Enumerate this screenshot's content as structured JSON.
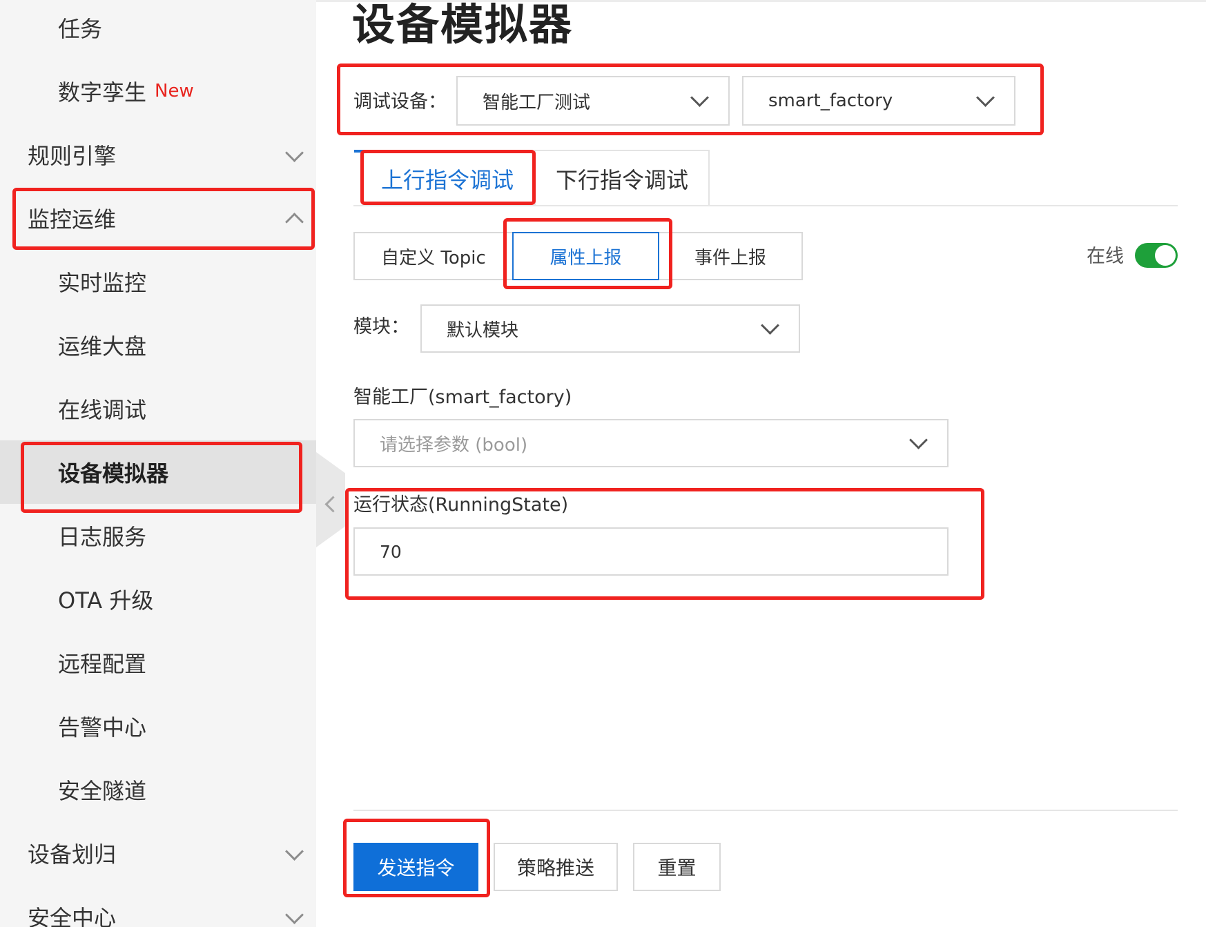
{
  "sidebar": {
    "items": [
      {
        "label": "任务"
      },
      {
        "label": "数字孪生",
        "badge": "New"
      },
      {
        "label": "规则引擎"
      },
      {
        "label": "监控运维"
      },
      {
        "label": "实时监控"
      },
      {
        "label": "运维大盘"
      },
      {
        "label": "在线调试"
      },
      {
        "label": "设备模拟器"
      },
      {
        "label": "日志服务"
      },
      {
        "label": "OTA 升级"
      },
      {
        "label": "远程配置"
      },
      {
        "label": "告警中心"
      },
      {
        "label": "安全隧道"
      },
      {
        "label": "设备划归"
      },
      {
        "label": "安全中心"
      }
    ]
  },
  "main": {
    "title": "设备模拟器",
    "debug_device_label": "调试设备：",
    "product_select": "智能工厂测试",
    "device_select": "smart_factory",
    "tabs": [
      {
        "label": "上行指令调试"
      },
      {
        "label": "下行指令调试"
      }
    ],
    "segments": [
      {
        "label": "自定义 Topic"
      },
      {
        "label": "属性上报"
      },
      {
        "label": "事件上报"
      }
    ],
    "online_label": "在线",
    "module_label": "模块：",
    "module_select": "默认模块",
    "group_label": "智能工厂(smart_factory)",
    "param_placeholder": "请选择参数 (bool)",
    "field_label": "运行状态(RunningState)",
    "field_value": "70",
    "buttons": {
      "send": "发送指令",
      "strategy": "策略推送",
      "reset": "重置"
    }
  },
  "colors": {
    "primary": "#0f6fd8",
    "annotation": "#f0221f",
    "toggle_on": "#1ea03a",
    "new_badge": "#e8231d"
  }
}
